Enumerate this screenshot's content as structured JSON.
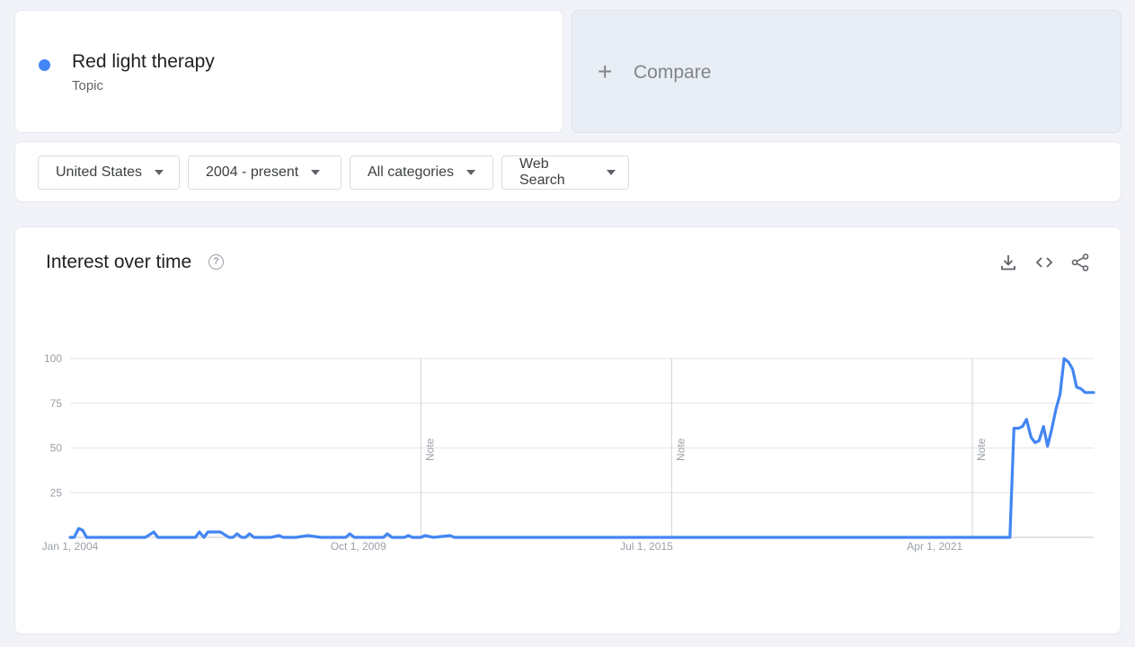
{
  "term": {
    "name": "Red light therapy",
    "type": "Topic",
    "color": "#4285f4"
  },
  "compare": {
    "icon": "plus-icon",
    "label": "Compare"
  },
  "filters": {
    "region": "United States",
    "time": "2004 - present",
    "category": "All categories",
    "property": "Web Search"
  },
  "chart": {
    "title": "Interest over time",
    "help_icon": "help-circle-icon",
    "actions": [
      "download-icon",
      "embed-code-icon",
      "share-icon"
    ]
  },
  "chart_data": {
    "type": "line",
    "title": "Interest over time",
    "xlabel": "",
    "ylabel": "",
    "ylim": [
      0,
      100
    ],
    "yticks": [
      100,
      75,
      50,
      25
    ],
    "xticks": [
      {
        "t": 0.0,
        "label": "Jan 1, 2004"
      },
      {
        "t": 5.75,
        "label": "Oct 1, 2009"
      },
      {
        "t": 11.5,
        "label": "Jul 1, 2015"
      },
      {
        "t": 17.25,
        "label": "Apr 1, 2021"
      }
    ],
    "notes": [
      {
        "t": 7.0,
        "label": "Note"
      },
      {
        "t": 12.0,
        "label": "Note"
      },
      {
        "t": 18.0,
        "label": "Note"
      }
    ],
    "grid": true,
    "series": [
      {
        "color": "#4285f4",
        "x": [
          0.0,
          0.08,
          0.17,
          0.25,
          0.33,
          0.5,
          0.67,
          1.0,
          1.5,
          1.67,
          1.75,
          1.83,
          2.0,
          2.5,
          2.58,
          2.67,
          2.75,
          3.0,
          3.17,
          3.25,
          3.33,
          3.42,
          3.5,
          3.58,
          3.67,
          3.75,
          3.83,
          4.0,
          4.17,
          4.25,
          4.33,
          4.5,
          4.75,
          5.0,
          5.5,
          5.58,
          5.67,
          6.25,
          6.33,
          6.42,
          6.67,
          6.75,
          6.83,
          6.92,
          7.0,
          7.08,
          7.25,
          7.58,
          7.67,
          7.75,
          8.0,
          9.0,
          12.0,
          15.0,
          18.0,
          18.75,
          18.83,
          18.92,
          19.0,
          19.08,
          19.17,
          19.25,
          19.33,
          19.42,
          19.5,
          19.58,
          19.67,
          19.75,
          19.83,
          19.92,
          20.0,
          20.08,
          20.17,
          20.25,
          20.33,
          20.42
        ],
        "y": [
          0,
          0,
          5,
          4,
          0,
          0,
          0,
          0,
          0,
          3,
          0,
          0,
          0,
          0,
          3,
          0,
          3,
          3,
          0,
          0,
          2,
          0,
          0,
          2,
          0,
          0,
          0,
          0,
          1,
          0,
          0,
          0,
          1,
          0,
          0,
          2,
          0,
          0,
          2,
          0,
          0,
          1,
          0,
          0,
          0,
          1,
          0,
          1,
          0,
          0,
          0,
          0,
          0,
          0,
          0,
          0,
          61,
          61,
          62,
          66,
          56,
          53,
          54,
          62,
          51,
          60,
          72,
          80,
          100,
          98,
          94,
          84,
          83,
          81,
          81,
          81
        ]
      }
    ]
  }
}
